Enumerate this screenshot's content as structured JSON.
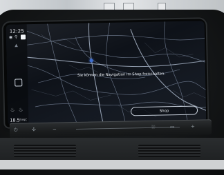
{
  "status": {
    "time": "12:25",
    "icons": [
      "signal-icon",
      "wifi-icon"
    ]
  },
  "sidebar": {
    "temperature": "18.5",
    "sync_label": "SYNC"
  },
  "navigation": {
    "message": "Sie können die Navigation im Shop freischalten.",
    "shop_button_label": "Shop"
  },
  "colors": {
    "screen_background": "#0d1117",
    "map_roads": "#8a98ad",
    "poi_marker": "#3e6fd0"
  }
}
